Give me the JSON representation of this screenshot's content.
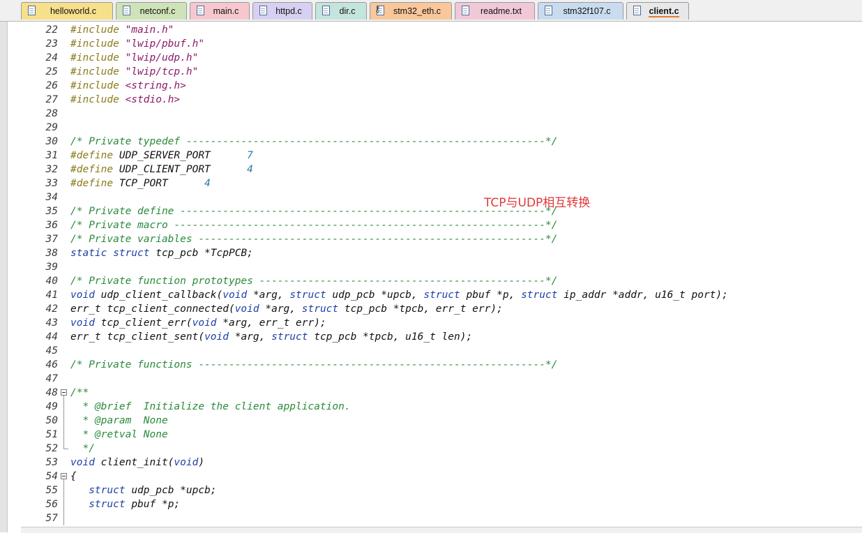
{
  "tabs": [
    {
      "label": "helloworld.c",
      "color": "#f7e08c",
      "icon": "file-icon"
    },
    {
      "label": "netconf.c",
      "color": "#cfe3b8",
      "icon": "file-icon"
    },
    {
      "label": "main.c",
      "color": "#f7c7cf",
      "icon": "file-icon"
    },
    {
      "label": "httpd.c",
      "color": "#d8d0f2",
      "icon": "file-icon"
    },
    {
      "label": "dir.c",
      "color": "#c4e4de",
      "icon": "file-icon"
    },
    {
      "label": "stm32_eth.c",
      "color": "#f9c79a",
      "icon": "file-key-icon"
    },
    {
      "label": "readme.txt",
      "color": "#f0c8d8",
      "icon": "file-icon"
    },
    {
      "label": "stm32f107.c",
      "color": "#c9dcef",
      "icon": "file-icon"
    },
    {
      "label": "client.c",
      "color": "#e8e8ea",
      "icon": "file-icon",
      "active": true
    }
  ],
  "annotation": "TCP与UDP相互转换",
  "code_lines": [
    {
      "n": "22",
      "tokens": [
        [
          "pp",
          "#include "
        ],
        [
          "str",
          "\"main.h\""
        ]
      ]
    },
    {
      "n": "23",
      "tokens": [
        [
          "pp",
          "#include "
        ],
        [
          "str",
          "\"lwip/pbuf.h\""
        ]
      ]
    },
    {
      "n": "24",
      "tokens": [
        [
          "pp",
          "#include "
        ],
        [
          "str",
          "\"lwip/udp.h\""
        ]
      ]
    },
    {
      "n": "25",
      "tokens": [
        [
          "pp",
          "#include "
        ],
        [
          "str",
          "\"lwip/tcp.h\""
        ]
      ]
    },
    {
      "n": "26",
      "tokens": [
        [
          "pp",
          "#include "
        ],
        [
          "str",
          "<string.h>"
        ]
      ]
    },
    {
      "n": "27",
      "tokens": [
        [
          "pp",
          "#include "
        ],
        [
          "str",
          "<stdio.h>"
        ]
      ]
    },
    {
      "n": "28",
      "tokens": []
    },
    {
      "n": "29",
      "tokens": []
    },
    {
      "n": "30",
      "tokens": [
        [
          "cm",
          "/* Private typedef -----------------------------------------------------------*/"
        ]
      ]
    },
    {
      "n": "31",
      "tokens": [
        [
          "pp",
          "#define "
        ],
        [
          "plain",
          "UDP_SERVER_PORT      "
        ],
        [
          "num",
          "7"
        ]
      ]
    },
    {
      "n": "32",
      "tokens": [
        [
          "pp",
          "#define "
        ],
        [
          "plain",
          "UDP_CLIENT_PORT      "
        ],
        [
          "num",
          "4"
        ]
      ]
    },
    {
      "n": "33",
      "tokens": [
        [
          "pp",
          "#define "
        ],
        [
          "plain",
          "TCP_PORT      "
        ],
        [
          "num",
          "4"
        ]
      ]
    },
    {
      "n": "34",
      "tokens": []
    },
    {
      "n": "35",
      "tokens": [
        [
          "cm",
          "/* Private define ------------------------------------------------------------*/"
        ]
      ]
    },
    {
      "n": "36",
      "tokens": [
        [
          "cm",
          "/* Private macro -------------------------------------------------------------*/"
        ]
      ]
    },
    {
      "n": "37",
      "tokens": [
        [
          "cm",
          "/* Private variables ---------------------------------------------------------*/"
        ]
      ]
    },
    {
      "n": "38",
      "tokens": [
        [
          "kw",
          "static struct "
        ],
        [
          "plain",
          "tcp_pcb *TcpPCB;"
        ]
      ]
    },
    {
      "n": "39",
      "tokens": []
    },
    {
      "n": "40",
      "tokens": [
        [
          "cm",
          "/* Private function prototypes -----------------------------------------------*/"
        ]
      ]
    },
    {
      "n": "41",
      "tokens": [
        [
          "kw",
          "void "
        ],
        [
          "plain",
          "udp_client_callback("
        ],
        [
          "kw",
          "void "
        ],
        [
          "plain",
          "*arg, "
        ],
        [
          "kw",
          "struct "
        ],
        [
          "plain",
          "udp_pcb *upcb, "
        ],
        [
          "kw",
          "struct "
        ],
        [
          "plain",
          "pbuf *p, "
        ],
        [
          "kw",
          "struct "
        ],
        [
          "plain",
          "ip_addr *addr, u16_t port);"
        ]
      ]
    },
    {
      "n": "42",
      "tokens": [
        [
          "plain",
          "err_t tcp_client_connected("
        ],
        [
          "kw",
          "void "
        ],
        [
          "plain",
          "*arg, "
        ],
        [
          "kw",
          "struct "
        ],
        [
          "plain",
          "tcp_pcb *tpcb, err_t err);"
        ]
      ]
    },
    {
      "n": "43",
      "tokens": [
        [
          "kw",
          "void "
        ],
        [
          "plain",
          "tcp_client_err("
        ],
        [
          "kw",
          "void "
        ],
        [
          "plain",
          "*arg, err_t err);"
        ]
      ]
    },
    {
      "n": "44",
      "tokens": [
        [
          "plain",
          "err_t tcp_client_sent("
        ],
        [
          "kw",
          "void "
        ],
        [
          "plain",
          "*arg, "
        ],
        [
          "kw",
          "struct "
        ],
        [
          "plain",
          "tcp_pcb *tpcb, u16_t len);"
        ]
      ]
    },
    {
      "n": "45",
      "tokens": []
    },
    {
      "n": "46",
      "tokens": [
        [
          "cm",
          "/* Private functions ---------------------------------------------------------*/"
        ]
      ]
    },
    {
      "n": "47",
      "tokens": []
    },
    {
      "n": "48",
      "tokens": [
        [
          "cm",
          "/**"
        ]
      ],
      "fold": "start"
    },
    {
      "n": "49",
      "tokens": [
        [
          "cm",
          "  * @brief  Initialize the client application."
        ]
      ],
      "fold": "mid"
    },
    {
      "n": "50",
      "tokens": [
        [
          "cm",
          "  * @param  None"
        ]
      ],
      "fold": "mid"
    },
    {
      "n": "51",
      "tokens": [
        [
          "cm",
          "  * @retval None"
        ]
      ],
      "fold": "mid"
    },
    {
      "n": "52",
      "tokens": [
        [
          "cm",
          "  */"
        ]
      ],
      "fold": "end"
    },
    {
      "n": "53",
      "tokens": [
        [
          "kw",
          "void "
        ],
        [
          "plain",
          "client_init("
        ],
        [
          "kw",
          "void"
        ],
        [
          "plain",
          ")"
        ]
      ]
    },
    {
      "n": "54",
      "tokens": [
        [
          "plain",
          "{"
        ]
      ],
      "fold": "start"
    },
    {
      "n": "55",
      "tokens": [
        [
          "plain",
          "   "
        ],
        [
          "kw",
          "struct "
        ],
        [
          "plain",
          "udp_pcb *upcb;"
        ]
      ],
      "fold": "mid"
    },
    {
      "n": "56",
      "tokens": [
        [
          "plain",
          "   "
        ],
        [
          "kw",
          "struct "
        ],
        [
          "plain",
          "pbuf *p;"
        ]
      ],
      "fold": "mid"
    },
    {
      "n": "57",
      "tokens": [],
      "fold": "mid"
    }
  ]
}
